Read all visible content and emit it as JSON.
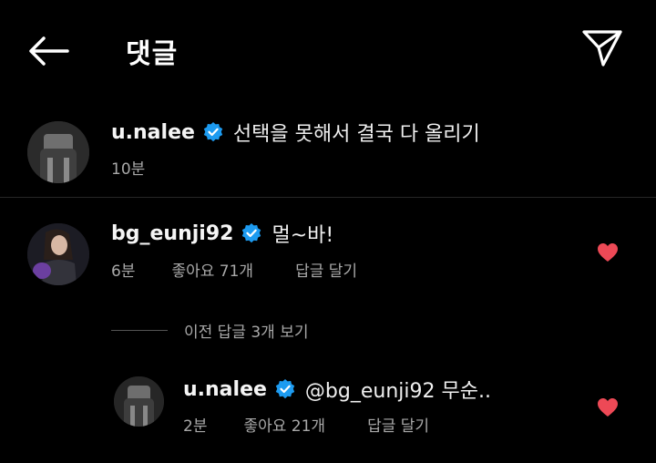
{
  "header": {
    "title": "댓글",
    "back_icon": "arrow-left-icon",
    "send_icon": "paper-plane-icon"
  },
  "comments": [
    {
      "username": "u.nalee",
      "verified": true,
      "text": "선택을 못해서 결국 다 올리기",
      "time": "10분"
    },
    {
      "username": "bg_eunji92",
      "verified": true,
      "text": "멀~바!",
      "time": "6분",
      "likes": "좋아요 71개",
      "reply_label": "답글 달기",
      "liked": true
    }
  ],
  "view_replies_label": "이전 답글 3개 보기",
  "reply": {
    "username": "u.nalee",
    "verified": true,
    "text": "@bg_eunji92 무순..",
    "time": "2분",
    "likes": "좋아요 21개",
    "reply_label": "답글 달기",
    "liked": true
  },
  "colors": {
    "background": "#000000",
    "verified_badge": "#1d9bf0",
    "heart": "#ed4956",
    "meta_text": "#a8a8a8"
  }
}
